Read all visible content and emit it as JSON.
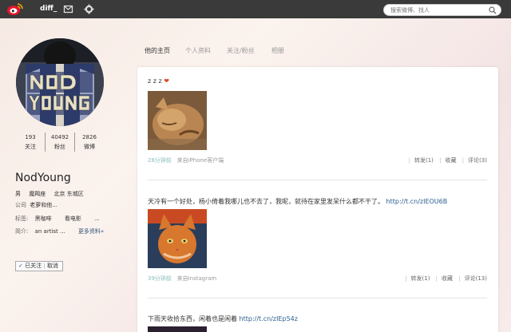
{
  "topbar": {
    "nav_label": "diff_",
    "search_placeholder": "搜索微博、找人"
  },
  "profile": {
    "name": "NodYoung",
    "stats": [
      {
        "count": "193",
        "label": "关注"
      },
      {
        "count": "40492",
        "label": "粉丝"
      },
      {
        "count": "2826",
        "label": "微博"
      }
    ],
    "gender": "男",
    "zodiac": "魔羯座",
    "location": "北京 东城区",
    "company_label": "公司",
    "company": "老萝和他...",
    "tags_label": "标签:",
    "tags": [
      "黑咖啡",
      "看电影",
      "..."
    ],
    "bio_label": "简介:",
    "bio": "an artist ...",
    "more_info": "更多资料»",
    "follow_status": "已关注",
    "cancel": "取消",
    "colors": {
      "accent": "#2a5d8f",
      "topbar": "#3a3a3a"
    }
  },
  "tabs": [
    "他的主页",
    "个人资料",
    "关注/粉丝",
    "相册"
  ],
  "posts": [
    {
      "text": "z z z",
      "link": "",
      "time": "28分钟前",
      "source_prefix": "来自",
      "source": "iPhone客户端",
      "repost": "转发(1)",
      "favorite": "收藏",
      "comment": "评论(3)"
    },
    {
      "text": "天冷有一个好处，杨小倚着我哪儿也不去了，我呢，就待在家里发呆什么都不干了。",
      "link": "http://t.cn/zIEOU6B",
      "time": "39分钟前",
      "source_prefix": "来自",
      "source": "Instagram",
      "repost": "转发(1)",
      "favorite": "收藏",
      "comment": "评论(13)"
    },
    {
      "text": "下雨天收拾东西，闲着也是闲着",
      "link": "http://t.cn/zIEp54z"
    }
  ]
}
